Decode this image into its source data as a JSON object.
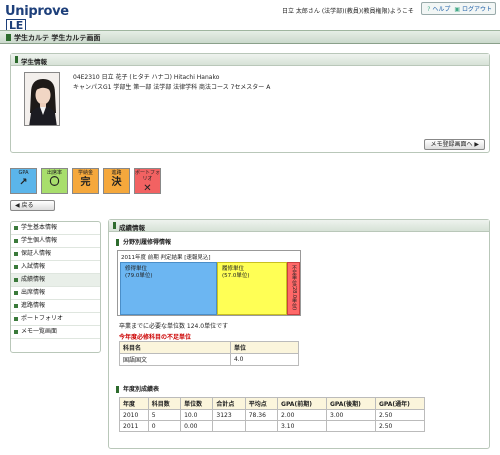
{
  "header": {
    "logo_main": "Uniprove",
    "logo_suffix": "LE",
    "user_greeting": "日立 太郎さん (法学部)(教員)(教員権限)ようこそ",
    "help_label": "ヘルプ",
    "logout_label": "ログアウト"
  },
  "page_title": "学生カルテ 学生カルテ画面",
  "student": {
    "panel_title": "学生情報",
    "line1": "04E2310  日立  花子  (ヒタチ  ハナコ)  Hitachi Hanako",
    "line2": "キャンパスG1  学部生  第一部  法学部  法律学科  商法コース  7セメスター  A",
    "memo_button": "メモ登録画面へ"
  },
  "badges": [
    {
      "label": "GPA",
      "symbol": "↗",
      "color": "#5bb5ea"
    },
    {
      "label": "出席率",
      "symbol": "〇",
      "color": "#a8de6c"
    },
    {
      "label": "学納金",
      "symbol": "完",
      "color": "#f5a83c"
    },
    {
      "label": "進路",
      "symbol": "決",
      "color": "#f5a83c"
    },
    {
      "label": "ポートフォリオ",
      "symbol": "✕",
      "color": "#f26262"
    }
  ],
  "back_button": "戻る",
  "menu": [
    {
      "label": "学生基本情報",
      "active": false
    },
    {
      "label": "学生個人情報",
      "active": false
    },
    {
      "label": "保証人情報",
      "active": false
    },
    {
      "label": "入試情報",
      "active": false
    },
    {
      "label": "成績情報",
      "active": true
    },
    {
      "label": "出席情報",
      "active": false
    },
    {
      "label": "進路情報",
      "active": false
    },
    {
      "label": "ポートフォリオ",
      "active": false
    },
    {
      "label": "メモ一覧画面",
      "active": false
    }
  ],
  "grades": {
    "panel_title": "成績情報",
    "section1_title": "分野別履修得情報",
    "summary_caption": "2011年度  前期  判定結果  [速報見込]",
    "bars": [
      {
        "label": "修得単位",
        "value": "(79.0単位)"
      },
      {
        "label": "履修単位",
        "value": "(57.0単位)"
      },
      {
        "label": "不足単位",
        "value": "(28.0単位)"
      }
    ],
    "remaining_text": "卒業までに必要な単位数  124.0単位です",
    "shortage_title": "今年度必修科目の不足単位",
    "shortage_headers": [
      "科目名",
      "単位"
    ],
    "shortage_rows": [
      [
        "国語国文",
        "4.0"
      ]
    ],
    "section2_title": "年度別成績表",
    "year_headers": [
      "年度",
      "科目数",
      "単位数",
      "合計点",
      "平均点",
      "GPA(前期)",
      "GPA(後期)",
      "GPA(通年)"
    ],
    "year_rows": [
      [
        "2010",
        "5",
        "10.0",
        "3123",
        "78.36",
        "2.00",
        "3.00",
        "2.50"
      ],
      [
        "2011",
        "0",
        "0.00",
        "",
        "",
        "3.10",
        "",
        "2.50"
      ]
    ]
  }
}
